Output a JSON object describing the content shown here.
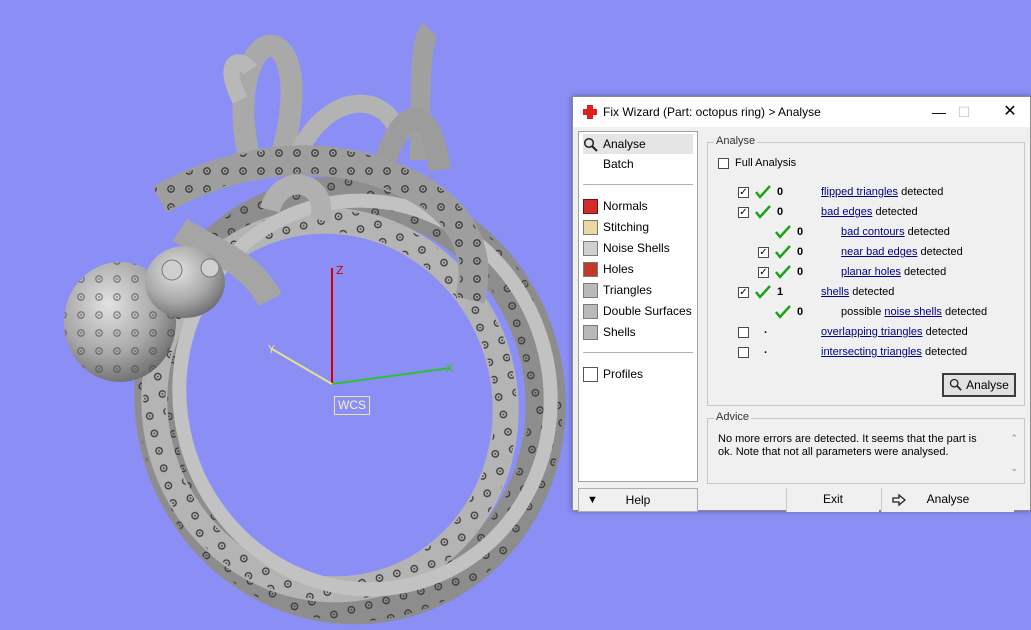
{
  "viewport": {
    "wcs_label": "WCS",
    "axis_z": "Z",
    "axis_x": "X",
    "axis_y": "Y"
  },
  "window": {
    "title": "Fix Wizard (Part: octopus ring) > Analyse",
    "icon": "red-cross-icon"
  },
  "sidebar": {
    "items": [
      {
        "label": "Analyse",
        "icon": "magnifier-icon"
      },
      {
        "label": "Batch",
        "icon": "batch-icon"
      },
      {
        "label": "Normals",
        "icon": "normals-icon"
      },
      {
        "label": "Stitching",
        "icon": "stitching-icon"
      },
      {
        "label": "Noise Shells",
        "icon": "noise-shells-icon"
      },
      {
        "label": "Holes",
        "icon": "holes-icon"
      },
      {
        "label": "Triangles",
        "icon": "triangles-icon"
      },
      {
        "label": "Double Surfaces",
        "icon": "double-surfaces-icon"
      },
      {
        "label": "Shells",
        "icon": "shells-icon"
      },
      {
        "label": "Profiles",
        "icon": "profiles-icon"
      }
    ]
  },
  "analyse": {
    "group_title": "Analyse",
    "full_analysis_label": "Full Analysis",
    "full_analysis_checked": false,
    "rows": [
      {
        "checked": true,
        "status": "ok",
        "count": "0",
        "link": "flipped triangles",
        "suffix": "detected"
      },
      {
        "checked": true,
        "status": "ok",
        "count": "0",
        "link": "bad edges",
        "suffix": "detected"
      },
      {
        "checked": null,
        "status": "ok",
        "count": "0",
        "link": "bad contours",
        "suffix": "detected"
      },
      {
        "checked": true,
        "status": "ok",
        "count": "0",
        "link": "near bad edges",
        "suffix": "detected"
      },
      {
        "checked": true,
        "status": "ok",
        "count": "0",
        "link": "planar holes",
        "suffix": "detected"
      },
      {
        "checked": true,
        "status": "ok",
        "count": "1",
        "link": "shells",
        "suffix": "detected"
      },
      {
        "checked": null,
        "status": "ok",
        "count": "0",
        "prefix": "possible",
        "link": "noise shells",
        "suffix": "detected"
      },
      {
        "checked": false,
        "status": "none",
        "count": ".",
        "link": "overlapping triangles",
        "suffix": "detected"
      },
      {
        "checked": false,
        "status": "none",
        "count": ".",
        "link": "intersecting triangles",
        "suffix": "detected"
      }
    ],
    "analyse_button": "Analyse"
  },
  "advice": {
    "group_title": "Advice",
    "text": "No more errors are detected. It seems that the part is ok. Note that not all parameters were analysed."
  },
  "bottom": {
    "help": "Help",
    "exit": "Exit",
    "analyse": "Analyse"
  },
  "colors": {
    "background": "#8b8ff5",
    "link": "#00008b",
    "ok_tick": "#1aa31a",
    "axis_z": "#d00000",
    "axis_x": "#2fbf2f",
    "axis_y": "#e7e28a"
  }
}
